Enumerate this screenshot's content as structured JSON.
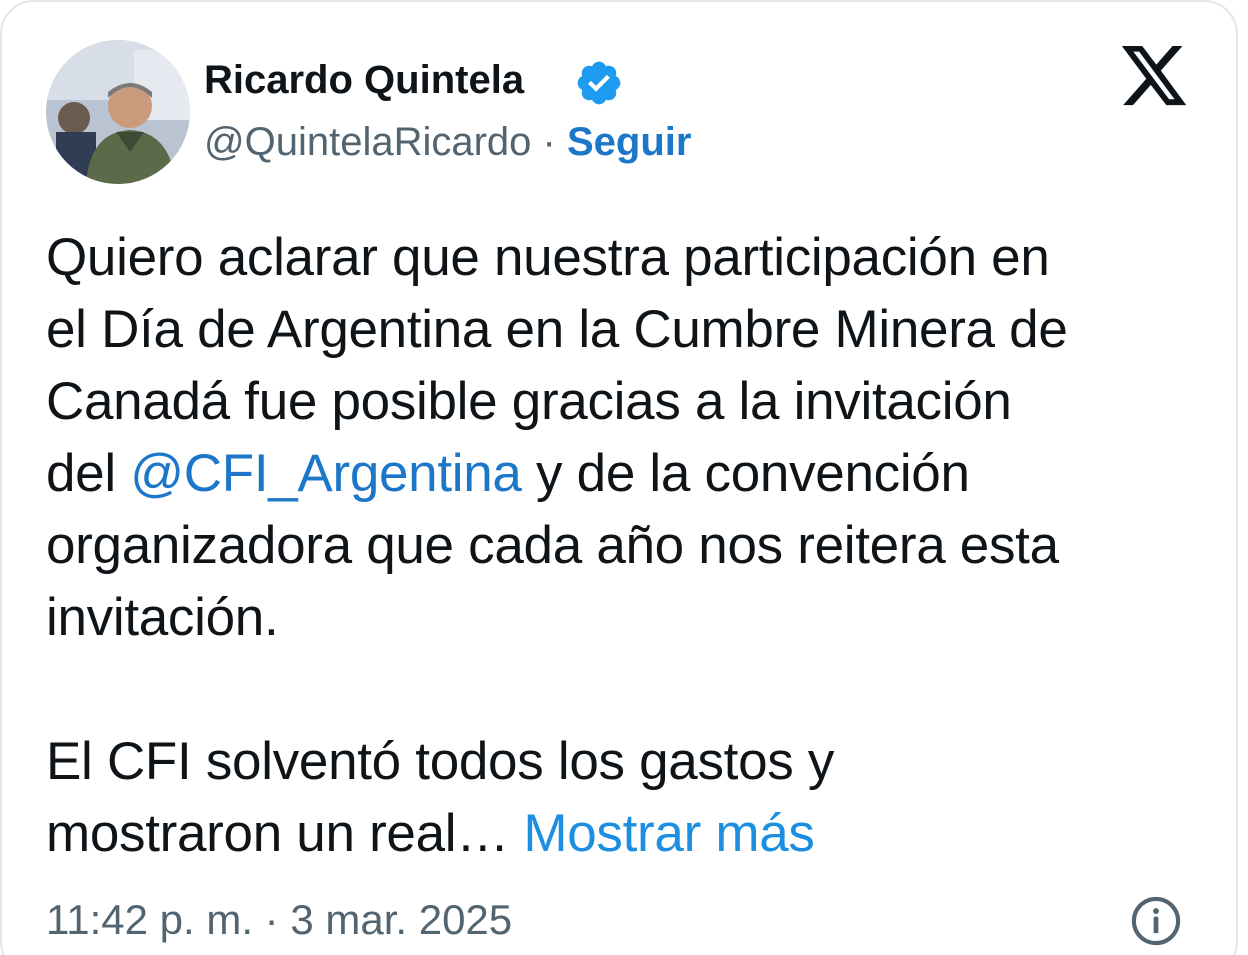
{
  "author": {
    "name": "Ricardo Quintela",
    "handle": "@QuintelaRicardo",
    "separator": "·",
    "follow_label": "Seguir",
    "verified_color": "#1d9bf0"
  },
  "icons": {
    "brand": "x-logo-icon",
    "verified": "verified-badge-icon",
    "info": "info-icon"
  },
  "tweet": {
    "line1": "Quiero aclarar que nuestra participación en",
    "line2": "el Día de Argentina en la Cumbre Minera de",
    "line3": "Canadá fue posible gracias a la invitación",
    "line4_prefix": "del ",
    "mention": "@CFI_Argentina",
    "line4_suffix": " y de la convención",
    "line5": "organizadora que cada año nos reitera esta",
    "line6": "invitación.",
    "line7": "El CFI solventó todos los gastos y",
    "line8_prefix": "mostraron un real… ",
    "show_more": "Mostrar más"
  },
  "meta": {
    "timestamp": "11:42 p. m. · 3 mar. 2025"
  },
  "colors": {
    "link": "#1d77c9",
    "text": "#0f1419",
    "muted": "#536471"
  }
}
